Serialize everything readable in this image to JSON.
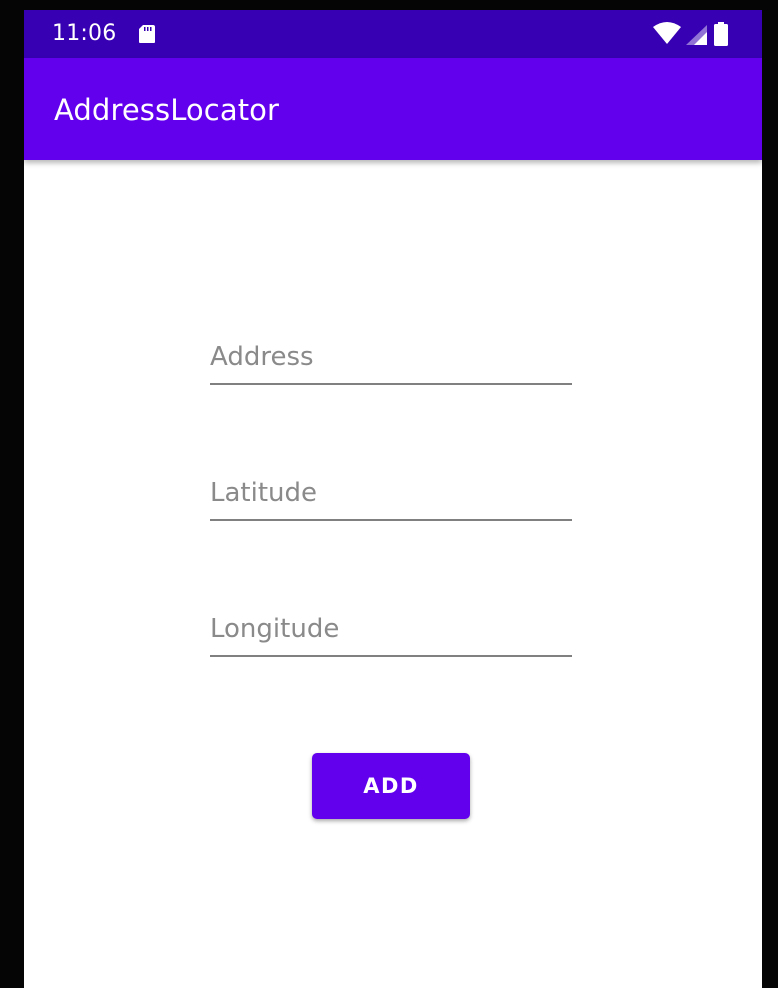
{
  "status_bar": {
    "time": "11:06",
    "icons": [
      "sd-card-icon",
      "wifi-icon",
      "signal-icon",
      "battery-icon"
    ]
  },
  "app_bar": {
    "title": "AddressLocator"
  },
  "form": {
    "address": {
      "placeholder": "Address",
      "value": ""
    },
    "latitude": {
      "placeholder": "Latitude",
      "value": ""
    },
    "longitude": {
      "placeholder": "Longitude",
      "value": ""
    },
    "add_button_label": "ADD"
  },
  "colors": {
    "status_bar": "#3700b3",
    "primary": "#6200ee",
    "background": "#ffffff",
    "hint_text": "#8a8a8a",
    "underline": "#808080"
  }
}
